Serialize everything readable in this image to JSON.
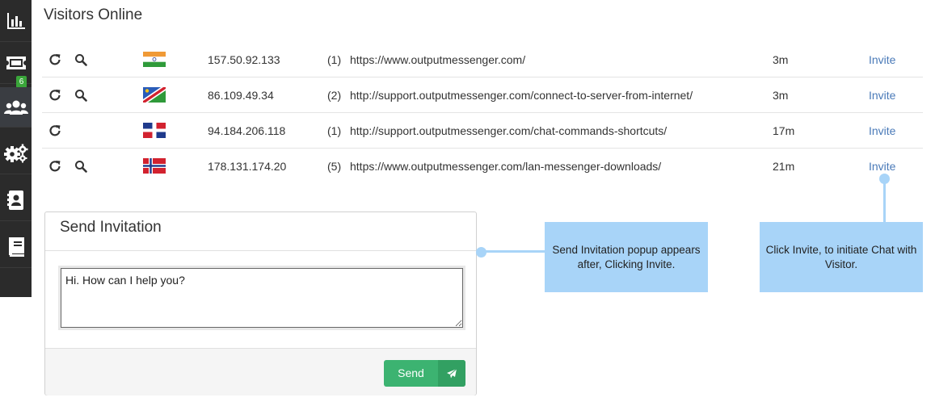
{
  "page": {
    "title": "Visitors Online"
  },
  "sidebar": {
    "items": [
      {
        "icon": "bar-chart-icon"
      },
      {
        "icon": "ticket-icon",
        "badge": "6"
      },
      {
        "icon": "users-icon",
        "active": true
      },
      {
        "icon": "gears-icon"
      },
      {
        "icon": "contact-book-icon"
      },
      {
        "icon": "book-icon"
      }
    ]
  },
  "visitors": [
    {
      "country": "India",
      "ip": "157.50.92.133",
      "count": "(1)",
      "url": "https://www.outputmessenger.com/",
      "time": "3m",
      "action": "Invite",
      "has_search": true
    },
    {
      "country": "Namibia",
      "ip": "86.109.49.34",
      "count": "(2)",
      "url": "http://support.outputmessenger.com/connect-to-server-from-internet/",
      "time": "3m",
      "action": "Invite",
      "has_search": true
    },
    {
      "country": "Dominican Republic",
      "ip": "94.184.206.118",
      "count": "(1)",
      "url": "http://support.outputmessenger.com/chat-commands-shortcuts/",
      "time": "17m",
      "action": "Invite",
      "has_search": false
    },
    {
      "country": "Norway",
      "ip": "178.131.174.20",
      "count": "(5)",
      "url": "https://www.outputmessenger.com/lan-messenger-downloads/",
      "time": "21m",
      "action": "Invite",
      "has_search": true
    }
  ],
  "popup": {
    "title": "Send Invitation",
    "message": "Hi. How can I help you?",
    "send_label": "Send"
  },
  "callouts": {
    "popup_note": "Send Invitation popup appears after, Clicking Invite.",
    "invite_note": "Click Invite, to initiate Chat with Visitor."
  },
  "colors": {
    "sidebar_bg": "#2b2b2b",
    "link": "#4a7ab8",
    "send_button": "#3cb371",
    "callout": "#a8d4f8",
    "badge": "#3aa63a"
  }
}
